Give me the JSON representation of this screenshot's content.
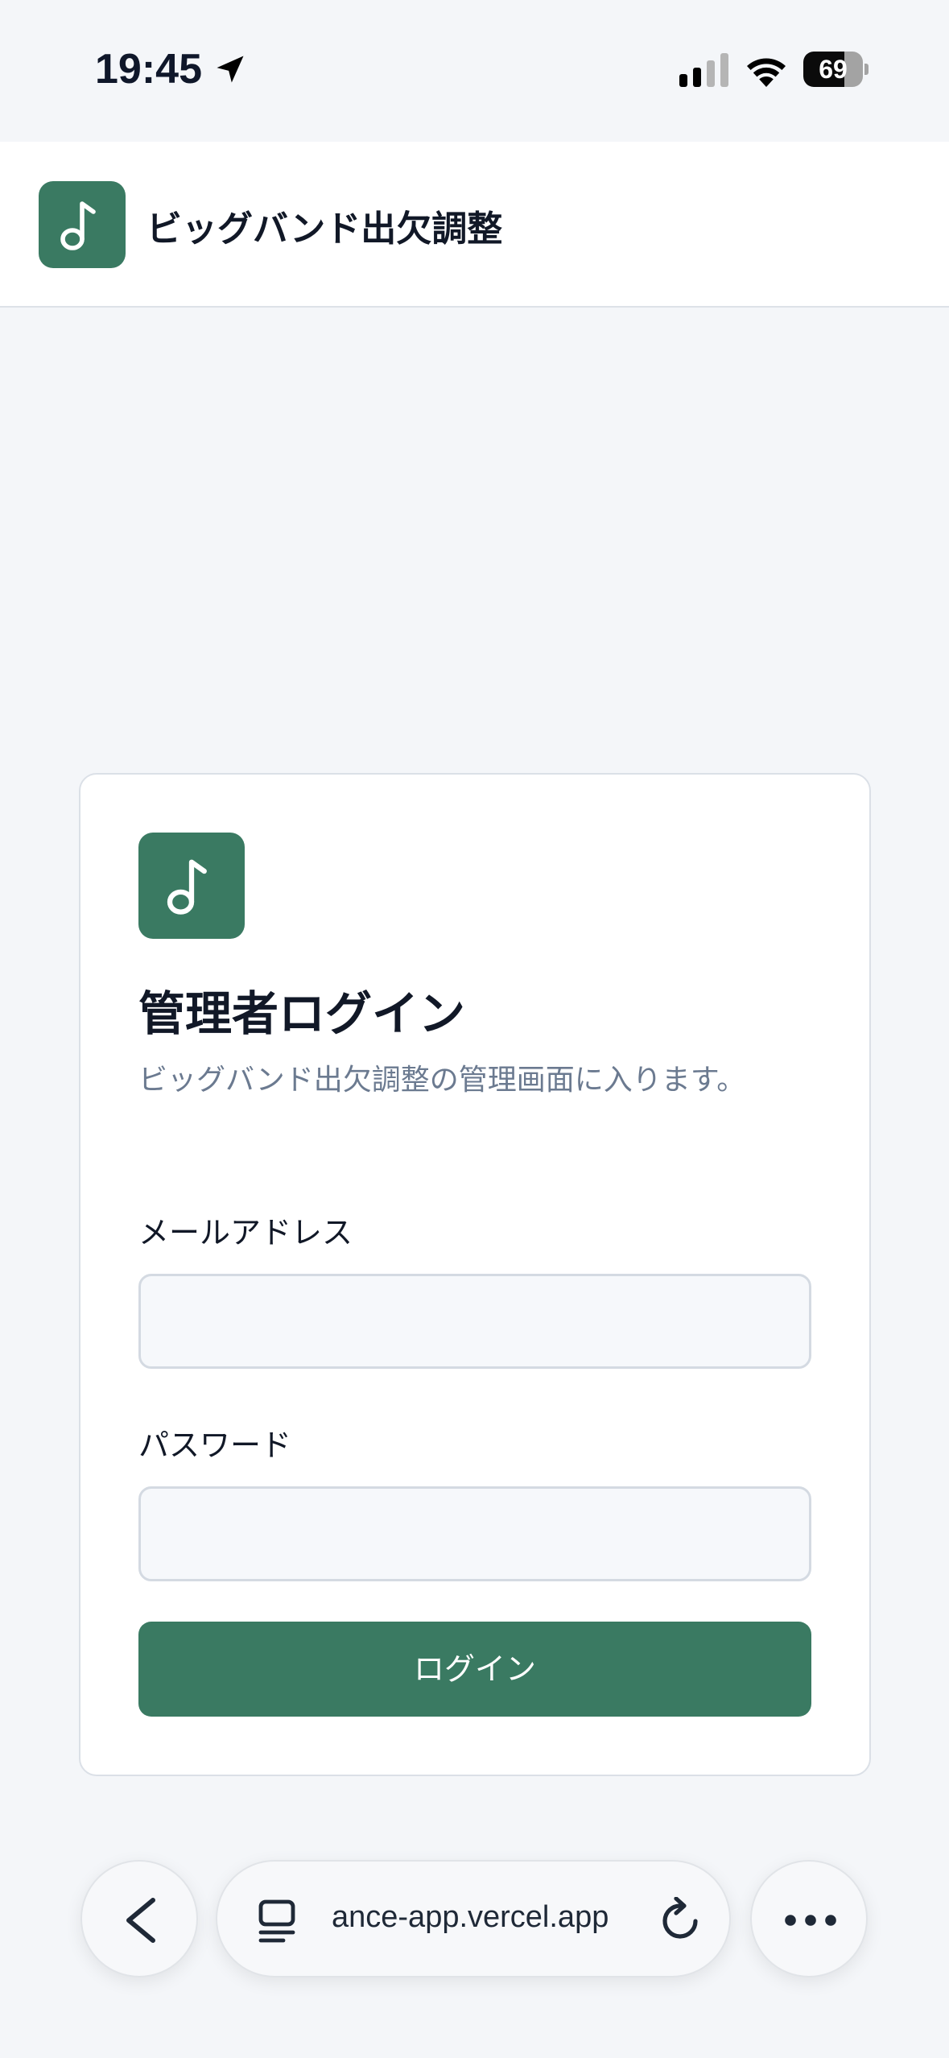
{
  "status_bar": {
    "time": "19:45",
    "battery_level": "69",
    "icons": [
      "location-arrow-icon",
      "cellular-signal-icon",
      "wifi-icon",
      "battery-icon"
    ]
  },
  "header": {
    "logo_icon": "music-note-icon",
    "title": "ビッグバンド出欠調整"
  },
  "login_card": {
    "logo_icon": "music-note-icon",
    "title": "管理者ログイン",
    "description": "ビッグバンド出欠調整の管理画面に入ります。",
    "email_label": "メールアドレス",
    "email_value": "",
    "password_label": "パスワード",
    "password_value": "",
    "submit_label": "ログイン"
  },
  "browser_toolbar": {
    "url": "ance-app.vercel.app",
    "icons": [
      "back-chevron-icon",
      "tabs-icon",
      "reload-icon",
      "more-dots-icon"
    ]
  },
  "colors": {
    "brand": "#3a7a62",
    "page_bg": "#f4f6f9",
    "muted_text": "#6b7a90"
  }
}
